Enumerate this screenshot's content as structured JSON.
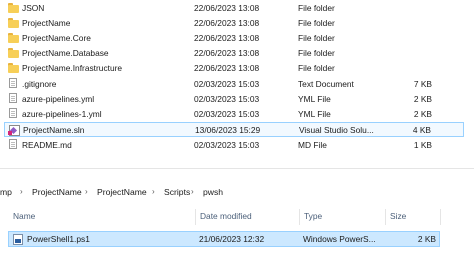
{
  "files_top": [
    {
      "name": "JSON",
      "date": "22/06/2023 13:08",
      "type": "File folder",
      "size": "",
      "icon": "folder-icon"
    },
    {
      "name": "ProjectName",
      "date": "22/06/2023 13:08",
      "type": "File folder",
      "size": "",
      "icon": "folder-icon"
    },
    {
      "name": "ProjectName.Core",
      "date": "22/06/2023 13:08",
      "type": "File folder",
      "size": "",
      "icon": "folder-icon"
    },
    {
      "name": "ProjectName.Database",
      "date": "22/06/2023 13:08",
      "type": "File folder",
      "size": "",
      "icon": "folder-icon"
    },
    {
      "name": "ProjectName.Infrastructure",
      "date": "22/06/2023 13:08",
      "type": "File folder",
      "size": "",
      "icon": "folder-icon"
    },
    {
      "name": ".gitignore",
      "date": "02/03/2023 15:03",
      "type": "Text Document",
      "size": "7 KB",
      "icon": "document-icon"
    },
    {
      "name": "azure-pipelines.yml",
      "date": "02/03/2023 15:03",
      "type": "YML File",
      "size": "2 KB",
      "icon": "document-icon"
    },
    {
      "name": "azure-pipelines-1.yml",
      "date": "02/03/2023 15:03",
      "type": "YML File",
      "size": "2 KB",
      "icon": "document-icon"
    },
    {
      "name": "ProjectName.sln",
      "date": "13/06/2023 15:29",
      "type": "Visual Studio Solu...",
      "size": "4 KB",
      "icon": "visual-studio-solution-icon"
    },
    {
      "name": "README.md",
      "date": "02/03/2023 15:03",
      "type": "MD File",
      "size": "1 KB",
      "icon": "document-icon"
    }
  ],
  "breadcrumb": [
    "mp",
    "ProjectName",
    "ProjectName",
    "Scripts",
    "pwsh"
  ],
  "breadcrumb_separator": "›",
  "columns": {
    "name": "Name",
    "date": "Date modified",
    "type": "Type",
    "size": "Size"
  },
  "bottom_file": {
    "name": "PowerShell1.ps1",
    "date": "21/06/2023 12:32",
    "type": "Windows PowerS...",
    "size": "2 KB",
    "icon": "powershell-script-icon"
  },
  "colors": {
    "selection": "#cce8ff",
    "selection_border": "#99d1ff",
    "folder": "#f7cf58",
    "header_text": "#4c607a"
  }
}
